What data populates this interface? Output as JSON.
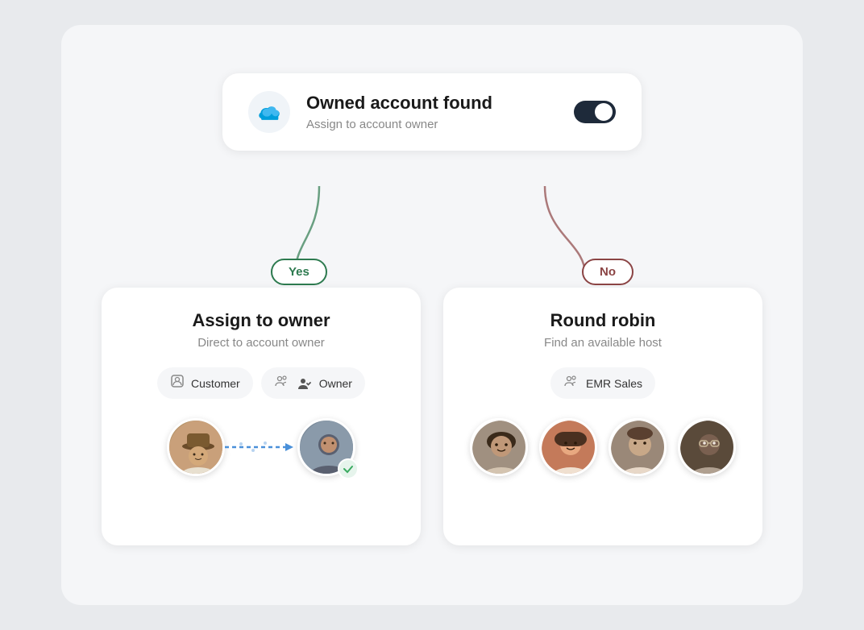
{
  "top_card": {
    "title": "Owned account found",
    "subtitle": "Assign to account owner",
    "toggle_on": true
  },
  "badge_yes": "Yes",
  "badge_no": "No",
  "left_card": {
    "title": "Assign to owner",
    "subtitle": "Direct to account owner",
    "tag1_label": "Customer",
    "tag2_label": "Owner",
    "check_symbol": "✓"
  },
  "right_card": {
    "title": "Round robin",
    "subtitle": "Find an available host",
    "tag_label": "EMR Sales"
  }
}
